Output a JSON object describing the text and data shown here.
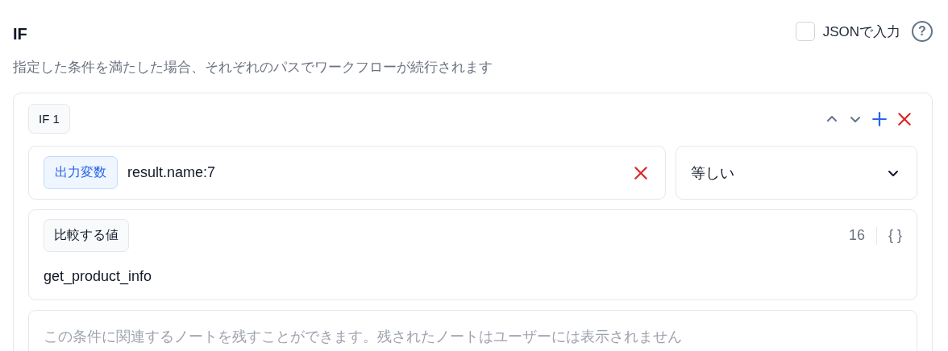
{
  "header": {
    "title": "IF",
    "json_input": {
      "label": "JSONで入力",
      "checked": false
    },
    "help_icon": "?"
  },
  "description": "指定した条件を満たした場合、それぞれのパスでワークフローが続行されます",
  "conditions": [
    {
      "label": "IF 1",
      "variable": {
        "tag": "出力変数",
        "value": "result.name:7"
      },
      "operator": "等しい",
      "compare": {
        "label": "比較する値",
        "count": "16",
        "format_icon": "{ }",
        "value": "get_product_info"
      },
      "note": {
        "placeholder": "この条件に関連するノートを残すことができます。残されたノートはユーザーには表示されません"
      }
    }
  ]
}
